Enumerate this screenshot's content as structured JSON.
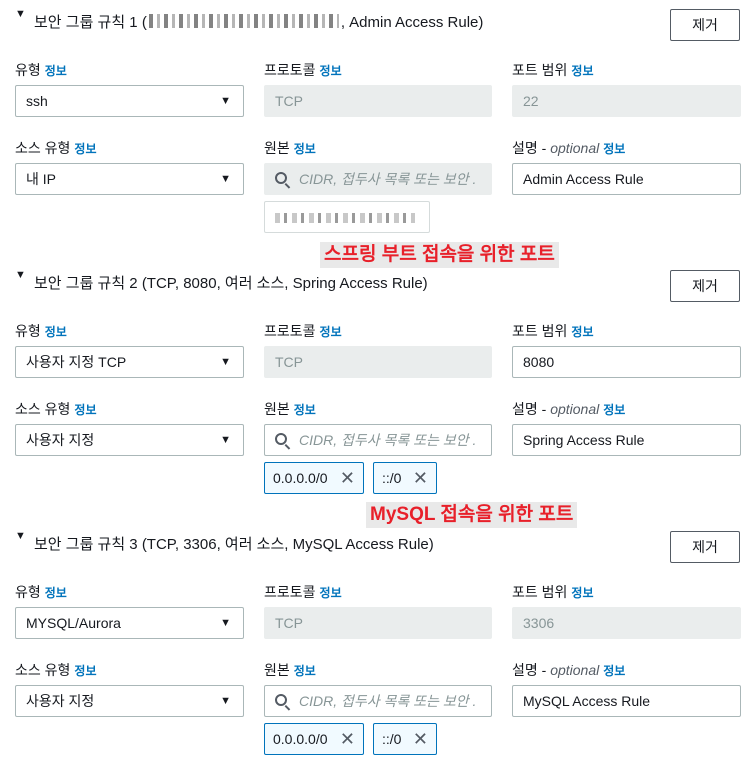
{
  "labels": {
    "type": "유형",
    "protocol": "프로토콜",
    "port_range": "포트 범위",
    "source_type": "소스 유형",
    "source": "원본",
    "description": "설명 - ",
    "optional": "optional",
    "info": "정보"
  },
  "remove_label": "제거",
  "source_placeholder": "CIDR, 접두사 목록 또는 보안 .",
  "annotations": {
    "spring": "스프링 부트 접속을 위한 포트",
    "mysql": "MySQL 접속을 위한 포트"
  },
  "rules": [
    {
      "title_prefix": "보안 그룹 규칙 1 (",
      "title_suffix": ", Admin Access Rule)",
      "type": "ssh",
      "protocol": "TCP",
      "port_range": "22",
      "source_type": "내 IP",
      "description": "Admin Access Rule",
      "tokens": []
    },
    {
      "title": "보안 그룹 규칙 2 (TCP, 8080, 여러 소스, Spring Access Rule)",
      "type": "사용자 지정 TCP",
      "protocol": "TCP",
      "port_range": "8080",
      "source_type": "사용자 지정",
      "description": "Spring Access Rule",
      "tokens": [
        "0.0.0.0/0",
        "::/0"
      ]
    },
    {
      "title": "보안 그룹 규칙 3 (TCP, 3306, 여러 소스, MySQL Access Rule)",
      "type": "MYSQL/Aurora",
      "protocol": "TCP",
      "port_range": "3306",
      "source_type": "사용자 지정",
      "description": "MySQL Access Rule",
      "tokens": [
        "0.0.0.0/0",
        "::/0"
      ]
    }
  ],
  "icons": {
    "expand": "caret-down-icon",
    "dropdown": "chevron-down-icon",
    "search": "search-icon",
    "remove_token": "close-icon"
  }
}
